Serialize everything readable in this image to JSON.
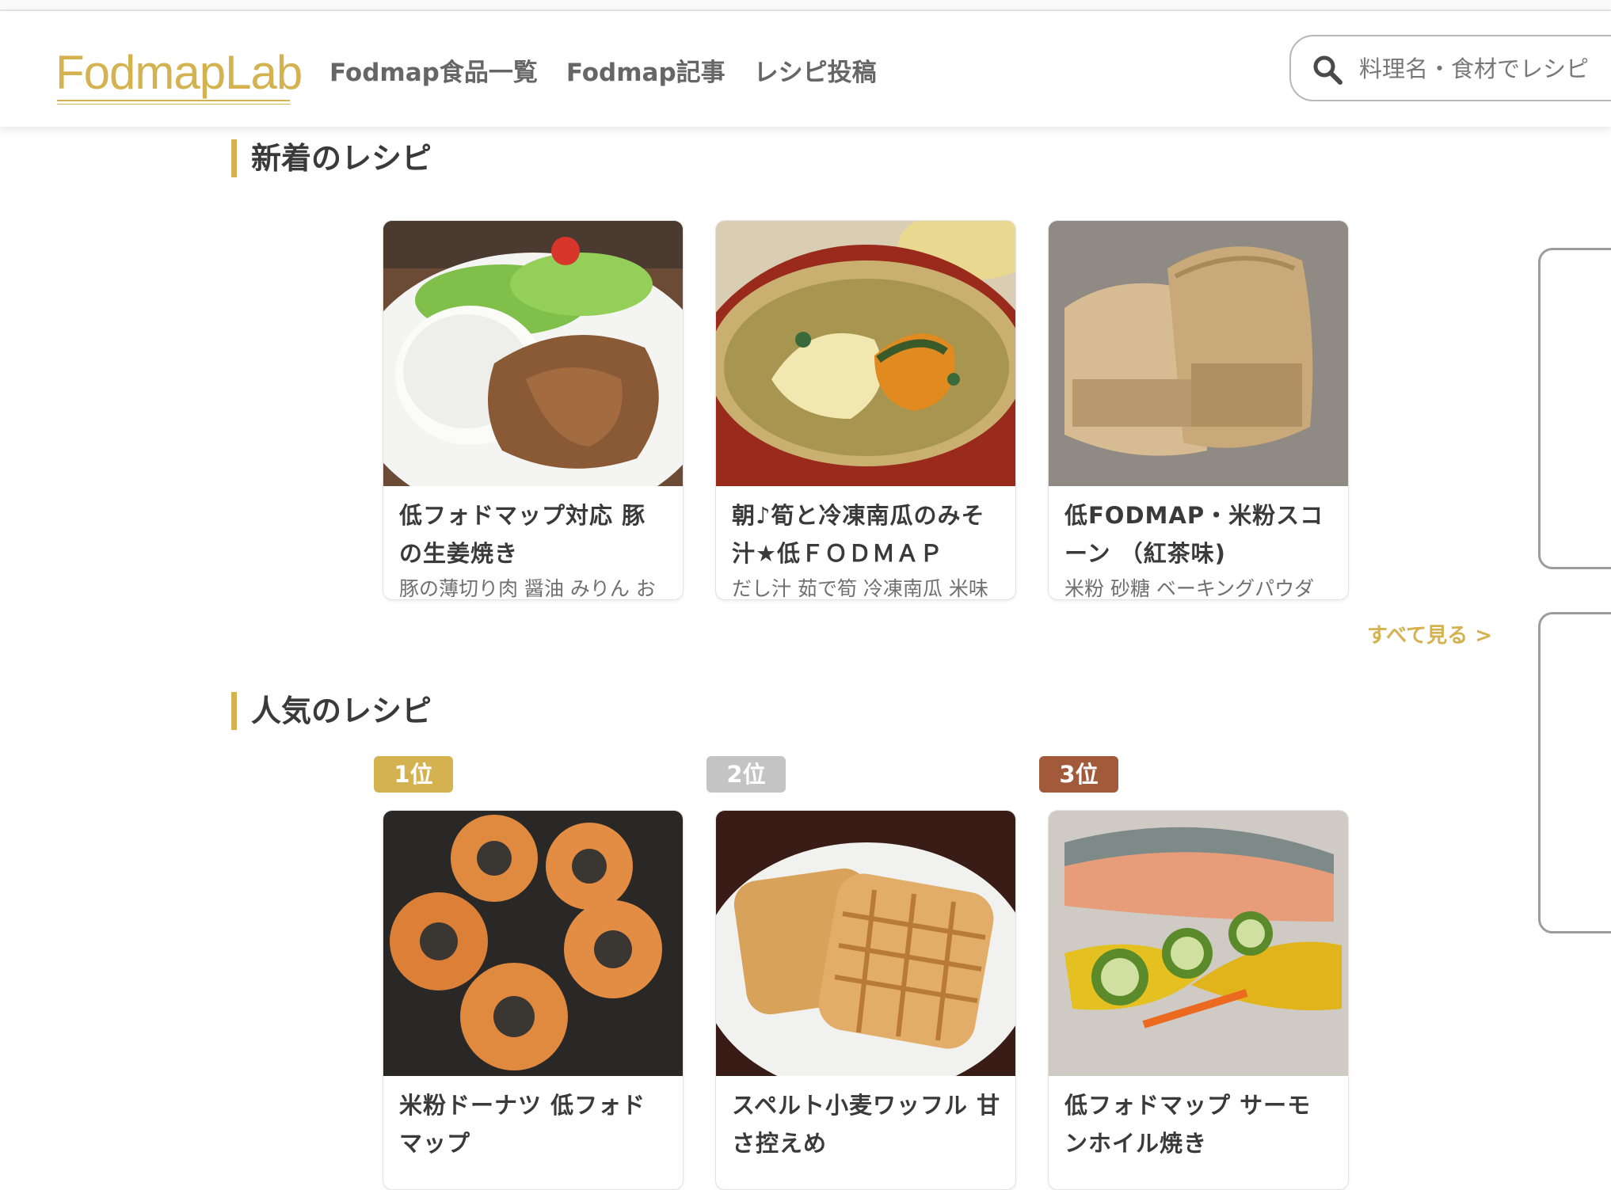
{
  "header": {
    "logo": "FodmapLab",
    "nav": [
      "Fodmap食品一覧",
      "Fodmap記事",
      "レシピ投稿"
    ],
    "search_placeholder": "料理名・食材でレシピ"
  },
  "new_recipes": {
    "title": "新着のレシピ",
    "see_all": "すべて見る >",
    "cards": [
      {
        "name": "低フォドマップ対応 豚の生姜焼き",
        "ingredients": "豚の薄切り肉 醤油 みりん お"
      },
      {
        "name": "朝♪筍と冷凍南瓜のみそ汁★低ＦＯＤＭＡＰ",
        "ingredients": "だし汁 茹で筍 冷凍南瓜 米味"
      },
      {
        "name": "低FODMAP・米粉スコーン （紅茶味)",
        "ingredients": "米粉 砂糖 ベーキングパウダ"
      }
    ]
  },
  "popular_recipes": {
    "title": "人気のレシピ",
    "cards": [
      {
        "rank": "1位",
        "rank_color": "#d3b24f",
        "name": "米粉ドーナツ 低フォドマップ"
      },
      {
        "rank": "2位",
        "rank_color": "#c4c4c4",
        "name": "スペルト小麦ワッフル 甘さ控えめ"
      },
      {
        "rank": "3位",
        "rank_color": "#a35a3a",
        "name": "低フォドマップ サーモンホイル焼き"
      }
    ]
  },
  "colors": {
    "accent": "#d3b24f"
  }
}
